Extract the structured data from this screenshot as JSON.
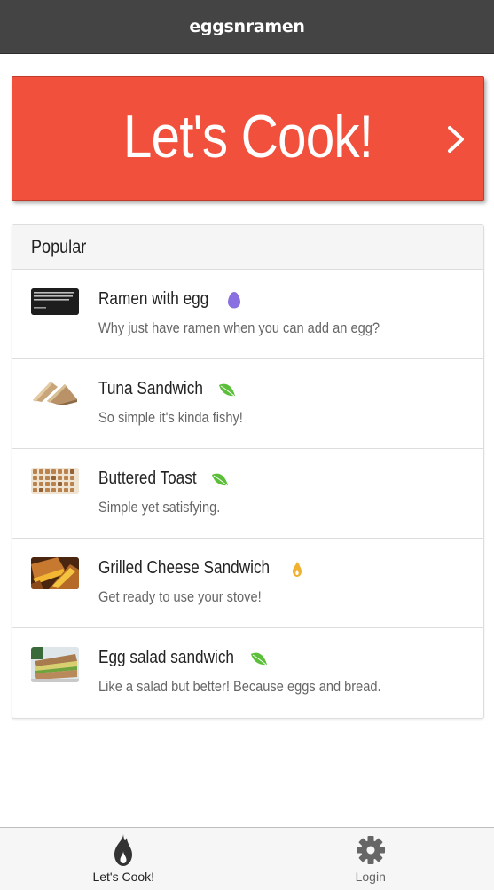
{
  "header": {
    "title": "eggsnramen"
  },
  "banner": {
    "label": "Let's Cook!",
    "chevron_icon": "chevron-right-icon"
  },
  "popular": {
    "title": "Popular",
    "items": [
      {
        "name": "Ramen with egg",
        "description": "Why just have ramen when you can add an egg?",
        "tag_icon": "egg-icon",
        "tag_color": "#8a6fe0",
        "thumb_text": "The image you are requesting does not exist or is no longer available.",
        "thumb_brand": "imgur.com"
      },
      {
        "name": "Tuna Sandwich",
        "description": "So simple it's kinda fishy!",
        "tag_icon": "leaf-icon",
        "tag_color": "#5cbf3a"
      },
      {
        "name": "Buttered Toast",
        "description": "Simple yet satisfying.",
        "tag_icon": "leaf-icon",
        "tag_color": "#5cbf3a"
      },
      {
        "name": "Grilled Cheese Sandwich",
        "description": "Get ready to use your stove!",
        "tag_icon": "flame-icon",
        "tag_color": "#f0b030"
      },
      {
        "name": "Egg salad sandwich",
        "description": "Like a salad but better! Because eggs and bread.",
        "tag_icon": "leaf-icon",
        "tag_color": "#5cbf3a"
      }
    ]
  },
  "tabs": [
    {
      "label": "Let's Cook!",
      "icon": "flame-icon",
      "active": true
    },
    {
      "label": "Login",
      "icon": "gear-icon",
      "active": false
    }
  ],
  "colors": {
    "header_bg": "#444444",
    "banner_bg": "#f0503c",
    "tab_active_icon": "#333333",
    "tab_inactive_icon": "#666666"
  }
}
